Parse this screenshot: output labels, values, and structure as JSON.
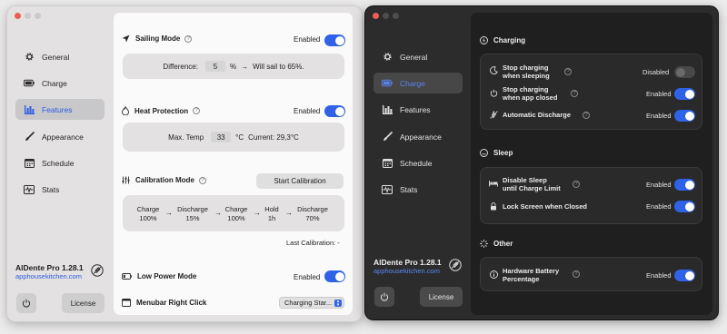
{
  "colors": {
    "accent": "#2f62e6",
    "accent_dark": "#5b84f0",
    "link": "#2c5ce0"
  },
  "sidebar": {
    "items": [
      {
        "label": "General",
        "icon": "gear-icon"
      },
      {
        "label": "Charge",
        "icon": "battery-icon"
      },
      {
        "label": "Features",
        "icon": "chart-bars-icon"
      },
      {
        "label": "Appearance",
        "icon": "paintbrush-icon"
      },
      {
        "label": "Schedule",
        "icon": "calendar-icon"
      },
      {
        "label": "Stats",
        "icon": "waveform-icon"
      }
    ],
    "app_name": "AlDente Pro 1.28.1",
    "app_link": "apphousekitchen.com",
    "license_label": "License"
  },
  "light": {
    "active_item": "Features",
    "sailing": {
      "title": "Sailing Mode",
      "state": "Enabled",
      "on": true,
      "difference_label": "Difference:",
      "difference_value": "5",
      "unit": "%",
      "arrow": "→",
      "result": "Will sail to 65%."
    },
    "heat": {
      "title": "Heat Protection",
      "state": "Enabled",
      "on": true,
      "max_temp_label": "Max. Temp",
      "max_temp_value": "33",
      "unit": "°C",
      "current": "Current: 29,3°C"
    },
    "calibration": {
      "title": "Calibration Mode",
      "button": "Start Calibration",
      "steps": [
        {
          "line1": "Charge",
          "line2": "100%"
        },
        {
          "line1": "Discharge",
          "line2": "15%"
        },
        {
          "line1": "Charge",
          "line2": "100%"
        },
        {
          "line1": "Hold",
          "line2": "1h"
        },
        {
          "line1": "Discharge",
          "line2": "70%"
        }
      ],
      "arrow": "→",
      "last": "Last Calibration: -"
    },
    "low_power": {
      "title": "Low Power Mode",
      "state": "Enabled",
      "on": true
    },
    "menubar": {
      "title": "Menubar Right Click",
      "selected": "Charging Star..."
    }
  },
  "dark": {
    "active_item": "Charge",
    "sections": {
      "charging": {
        "title": "Charging",
        "rows": [
          {
            "label1": "Stop charging",
            "label2": "when sleeping",
            "state": "Disabled",
            "on": false
          },
          {
            "label1": "Stop charging",
            "label2": "when app closed",
            "state": "Enabled",
            "on": true
          },
          {
            "label1": "Automatic Discharge",
            "label2": "",
            "state": "Enabled",
            "on": true
          }
        ]
      },
      "sleep": {
        "title": "Sleep",
        "rows": [
          {
            "label1": "Disable Sleep",
            "label2": "until Charge Limit",
            "state": "Enabled",
            "on": true
          },
          {
            "label1": "Lock Screen when Closed",
            "label2": "",
            "state": "Enabled",
            "on": true
          }
        ]
      },
      "other": {
        "title": "Other",
        "rows": [
          {
            "label1": "Hardware Battery",
            "label2": "Percentage",
            "state": "Enabled",
            "on": true
          }
        ]
      }
    }
  }
}
